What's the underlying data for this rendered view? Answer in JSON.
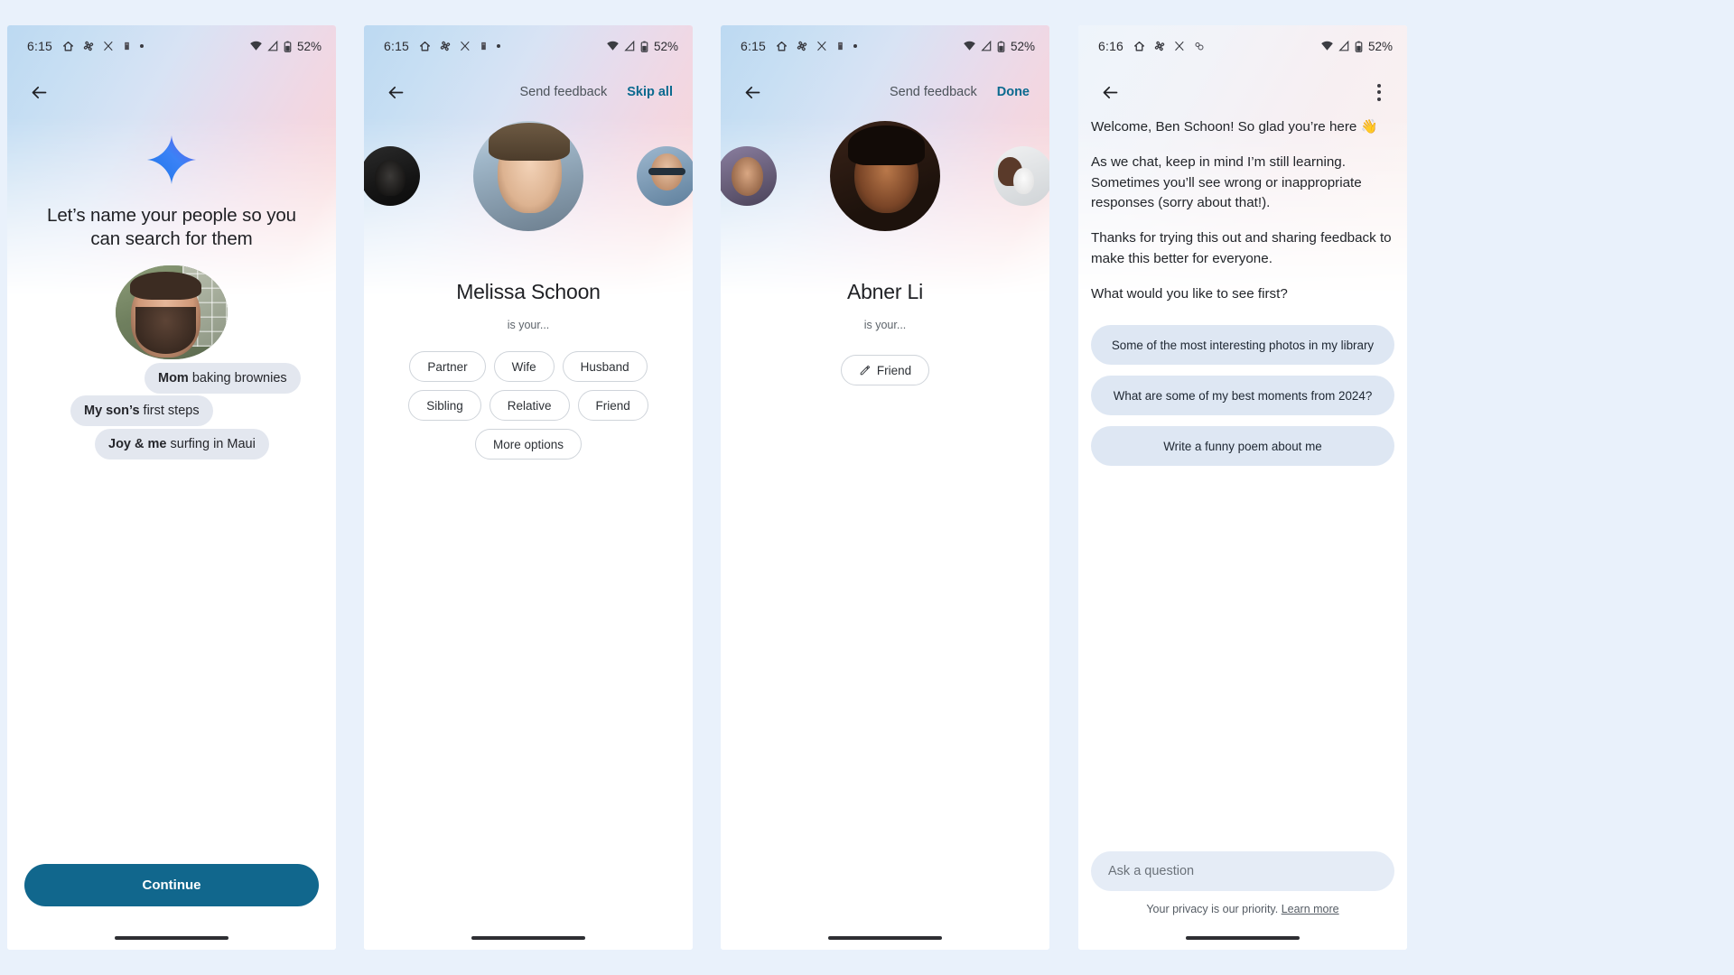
{
  "background_color": "#e9f1fb",
  "accent_color": "#0b6a8f",
  "cta_color": "#11678d",
  "screens": [
    {
      "id": "name-people",
      "statusbar": {
        "time": "6:15",
        "battery": "52%",
        "left_icons": [
          "home-icon",
          "pinwheel-icon",
          "x-icon",
          "app-icon",
          "dot-icon"
        ],
        "right_icons": [
          "wifi-icon",
          "signal-icon",
          "battery-icon"
        ]
      },
      "appbar": {
        "back": "back-arrow-icon"
      },
      "title": "Let’s name your people so you can search for them",
      "sparkle_icon": "gemini-sparkle-icon",
      "bubbles": [
        {
          "bold": "Mom",
          "rest": " baking brownies"
        },
        {
          "bold": "My son’s",
          "rest": " first steps"
        },
        {
          "bold": "Joy & me",
          "rest": " surfing in Maui"
        }
      ],
      "cta_label": "Continue"
    },
    {
      "id": "melissa-schoon",
      "statusbar": {
        "time": "6:15",
        "battery": "52%",
        "left_icons": [
          "home-icon",
          "pinwheel-icon",
          "x-icon",
          "app-icon",
          "dot-icon"
        ],
        "right_icons": [
          "wifi-icon",
          "signal-icon",
          "battery-icon"
        ]
      },
      "appbar": {
        "back": "back-arrow-icon",
        "send_feedback": "Send feedback",
        "action": "Skip all"
      },
      "person_name": "Melissa Schoon",
      "is_your": "is your...",
      "chips": [
        "Partner",
        "Wife",
        "Husband",
        "Sibling",
        "Relative",
        "Friend",
        "More options"
      ]
    },
    {
      "id": "abner-li",
      "statusbar": {
        "time": "6:15",
        "battery": "52%",
        "left_icons": [
          "home-icon",
          "pinwheel-icon",
          "x-icon",
          "app-icon",
          "dot-icon"
        ],
        "right_icons": [
          "wifi-icon",
          "signal-icon",
          "battery-icon"
        ]
      },
      "appbar": {
        "back": "back-arrow-icon",
        "send_feedback": "Send feedback",
        "action": "Done"
      },
      "person_name": "Abner Li",
      "is_your": "is your...",
      "chips": [
        "Friend"
      ]
    },
    {
      "id": "ask-photos-welcome",
      "statusbar": {
        "time": "6:16",
        "battery": "52%",
        "left_icons": [
          "home-icon",
          "pinwheel-icon",
          "x-icon",
          "app-icon"
        ],
        "right_icons": [
          "wifi-icon",
          "signal-icon",
          "battery-icon"
        ]
      },
      "appbar": {
        "back": "back-arrow-icon",
        "overflow": "more-options-icon"
      },
      "paragraphs": [
        "Welcome, Ben Schoon! So glad you’re here 👋",
        "As we chat, keep in mind I’m still learning. Sometimes you’ll see wrong or inappropriate responses (sorry about that!).",
        "Thanks for trying this out and sharing feedback to make this better for everyone.",
        "What would you like to see first?"
      ],
      "suggestions": [
        "Some of the most interesting photos in my library",
        "What are some of my best moments from 2024?",
        "Write a funny poem about me"
      ],
      "input_placeholder": "Ask a question",
      "privacy_text": "Your privacy is our priority. ",
      "privacy_link": "Learn more"
    }
  ]
}
